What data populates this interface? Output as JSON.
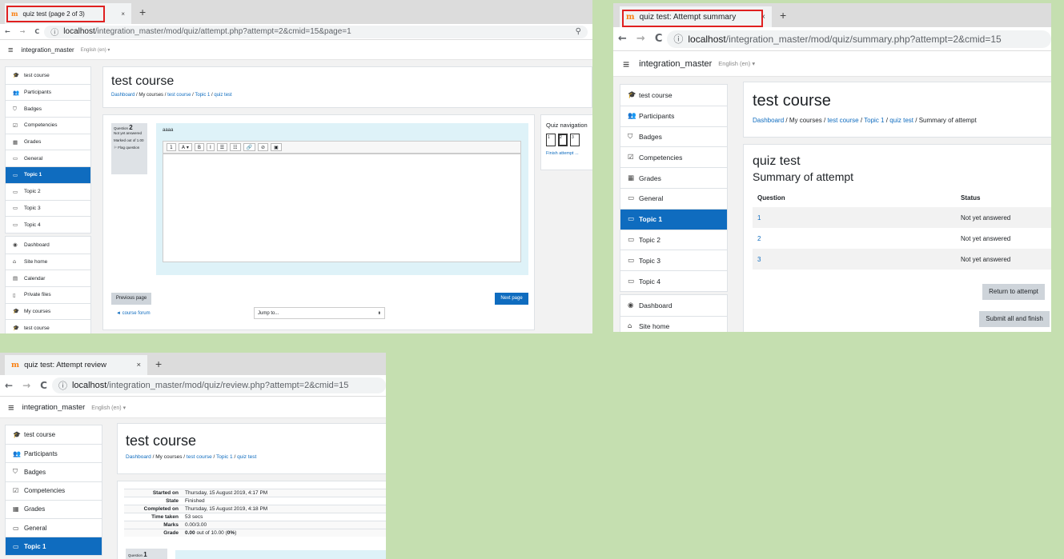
{
  "panel1": {
    "tab_title": "quiz test (page 2 of 3)",
    "url_host": "localhost",
    "url_path": "/integration_master/mod/quiz/attempt.php?attempt=2&cmid=15&page=1",
    "site_name": "integration_master",
    "language": "English (en) ▾",
    "sidebar": [
      [
        "test course",
        "Participants",
        "Badges",
        "Competencies",
        "Grades",
        "General",
        "Topic 1",
        "Topic 2",
        "Topic 3",
        "Topic 4"
      ],
      [
        "Dashboard",
        "Site home",
        "Calendar",
        "Private files",
        "My courses",
        "test course"
      ]
    ],
    "course_title": "test course",
    "breadcrumb": {
      "dashboard": "Dashboard",
      "my_courses": "My courses",
      "course": "test course",
      "topic": "Topic 1",
      "quiz": "quiz test",
      "sep": "/"
    },
    "question": {
      "label": "Question",
      "number": "2",
      "status": "Not yet answered",
      "marked": "Marked out of 1.00",
      "flag": "Flag question",
      "text": "aaaa"
    },
    "editor_buttons": [
      "1",
      "A ▾",
      "B",
      "I",
      "☰",
      "☷",
      "🔗",
      "⊘",
      "▣"
    ],
    "quiz_nav": {
      "title": "Quiz navigation",
      "buttons": [
        "1",
        "2",
        "3"
      ],
      "finish": "Finish attempt ..."
    },
    "prev_page": "Previous page",
    "next_page": "Next page",
    "forum_link": "◄ course forum",
    "jump_to": "Jump to...",
    "jump_arrow": "⬍",
    "zoom_icon": "⚲"
  },
  "panel2": {
    "tab_title": "quiz test: Attempt summary",
    "url_host": "localhost",
    "url_path": "/integration_master/mod/quiz/summary.php?attempt=2&cmid=15",
    "site_name": "integration_master",
    "language": "English (en) ▾",
    "sidebar": [
      [
        "test course",
        "Participants",
        "Badges",
        "Competencies",
        "Grades",
        "General",
        "Topic 1",
        "Topic 2",
        "Topic 3",
        "Topic 4"
      ],
      [
        "Dashboard",
        "Site home"
      ]
    ],
    "course_title": "test course",
    "breadcrumb": {
      "dashboard": "Dashboard",
      "my_courses": "My courses",
      "course": "test course",
      "topic": "Topic 1",
      "quiz": "quiz test",
      "current": "Summary of attempt",
      "sep": "/"
    },
    "quiz_title": "quiz test",
    "summary_title": "Summary of attempt",
    "table_headers": [
      "Question",
      "Status"
    ],
    "rows": [
      [
        "1",
        "Not yet answered"
      ],
      [
        "2",
        "Not yet answered"
      ],
      [
        "3",
        "Not yet answered"
      ]
    ],
    "return_btn": "Return to attempt",
    "submit_btn": "Submit all and finish"
  },
  "panel3": {
    "tab_title": "quiz test: Attempt review",
    "url_host": "localhost",
    "url_path": "/integration_master/mod/quiz/review.php?attempt=2&cmid=15",
    "site_name": "integration_master",
    "language": "English (en) ▾",
    "sidebar": [
      [
        "test course",
        "Participants",
        "Badges",
        "Competencies",
        "Grades",
        "General",
        "Topic 1"
      ]
    ],
    "course_title": "test course",
    "breadcrumb": {
      "dashboard": "Dashboard",
      "my_courses": "My courses",
      "course": "test course",
      "topic": "Topic 1",
      "quiz": "quiz test",
      "sep": "/"
    },
    "review": [
      {
        "label": "Started on",
        "value": "Thursday, 15 August 2019, 4:17 PM"
      },
      {
        "label": "State",
        "value": "Finished"
      },
      {
        "label": "Completed on",
        "value": "Thursday, 15 August 2019, 4:18 PM"
      },
      {
        "label": "Time taken",
        "value": "53 secs"
      },
      {
        "label": "Marks",
        "value": "0.00/3.00"
      }
    ],
    "grade": {
      "label": "Grade",
      "value": "0.00",
      "rest": " out of 10.00 (",
      "pct": "0%",
      "end": ")"
    },
    "next_question": {
      "label": "Question",
      "number": "1"
    }
  },
  "common": {
    "back": "←",
    "forward": "→",
    "reload": "C",
    "info": "ⓘ",
    "close": "×",
    "newtab": "+",
    "menu": "≡",
    "favicon": "m"
  },
  "colors": {
    "page_bg": "#c5dfb0",
    "brand": "#0f6cbf",
    "highlight": "#e02020"
  }
}
